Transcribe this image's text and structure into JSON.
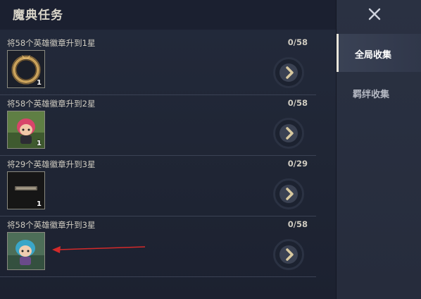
{
  "header": {
    "title": "魔典任务"
  },
  "sidebar": {
    "tabs": [
      {
        "label": "全局收集",
        "active": true
      },
      {
        "label": "羁绊收集",
        "active": false
      }
    ]
  },
  "tasks": [
    {
      "description": "将58个英雄徽章升到1星",
      "progress": "0/58",
      "count": "1",
      "icon": "golden-ring-icon"
    },
    {
      "description": "将58个英雄徽章升到2星",
      "progress": "0/58",
      "count": "1",
      "icon": "pink-hair-chibi-hero-icon"
    },
    {
      "description": "将29个英雄徽章升到3星",
      "progress": "0/29",
      "count": "1",
      "icon": "nameplate-badge-icon"
    },
    {
      "description": "将58个英雄徽章升到3星",
      "progress": "0/58",
      "count": "",
      "icon": "blue-hair-chibi-hero-icon"
    }
  ],
  "colors": {
    "accent_arrow": "#d42a2a",
    "gold": "#c9a15a",
    "chevron": "#d8c9a0"
  }
}
